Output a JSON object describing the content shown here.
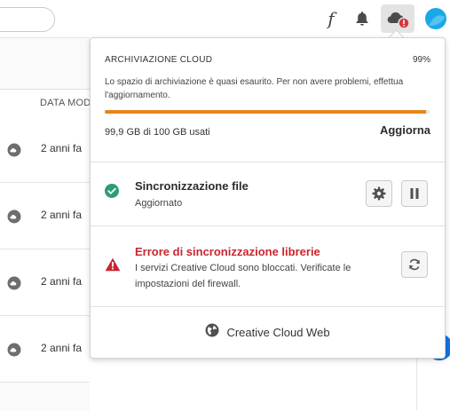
{
  "topbar": {
    "icons": [
      "fonts-icon",
      "bell-icon",
      "cloud-alert-icon",
      "avatar"
    ]
  },
  "table": {
    "column_header": "DATA MOD",
    "rows": [
      {
        "date": "2 anni fa"
      },
      {
        "date": "2 anni fa"
      },
      {
        "date": "2 anni fa"
      },
      {
        "date": "2 anni fa"
      }
    ]
  },
  "storage": {
    "title": "ARCHIVIAZIONE CLOUD",
    "percent_label": "99%",
    "percent": 0.99,
    "message": "Lo spazio di archiviazione è quasi esaurito. Per non avere problemi, effettua l'aggiornamento.",
    "used": "99,9 GB di 100 GB usati",
    "upgrade_label": "Aggiorna",
    "bar_color": "#e68619"
  },
  "sync": {
    "title": "Sincronizzazione file",
    "status": "Aggiornato",
    "icon": "checkmark-circle-icon",
    "color": "#2d9d78"
  },
  "library_error": {
    "title": "Errore di sincronizzazione librerie",
    "message": "I servizi Creative Cloud sono bloccati. Verificate le impostazioni del firewall.",
    "icon": "alert-triangle-icon",
    "color": "#c9252d"
  },
  "web": {
    "label": "Creative Cloud Web",
    "icon": "globe-icon"
  }
}
